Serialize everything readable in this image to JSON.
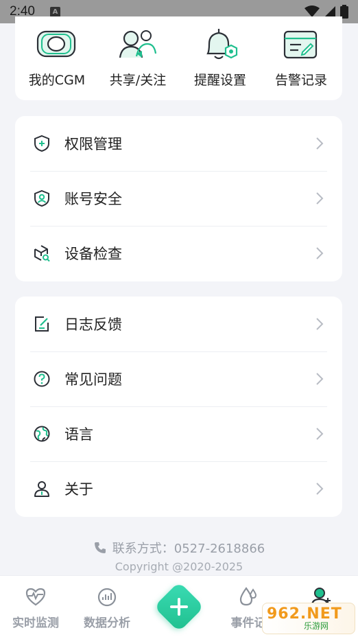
{
  "status_bar": {
    "time": "2:40",
    "notif_glyph": "A"
  },
  "quick_actions": [
    {
      "label": "我的CGM",
      "icon": "cgm-sensor-icon"
    },
    {
      "label": "共享/关注",
      "icon": "share-follow-icon"
    },
    {
      "label": "提醒设置",
      "icon": "reminder-bell-icon"
    },
    {
      "label": "告警记录",
      "icon": "alarm-record-icon"
    }
  ],
  "menu_group_1": [
    {
      "label": "权限管理",
      "icon": "shield-plus-icon"
    },
    {
      "label": "账号安全",
      "icon": "shield-user-icon"
    },
    {
      "label": "设备检查",
      "icon": "device-check-icon"
    }
  ],
  "menu_group_2": [
    {
      "label": "日志反馈",
      "icon": "log-edit-icon"
    },
    {
      "label": "常见问题",
      "icon": "question-circle-icon"
    },
    {
      "label": "语言",
      "icon": "globe-icon"
    },
    {
      "label": "关于",
      "icon": "about-user-icon"
    }
  ],
  "contact": {
    "text": "联系方式：0527-2618866",
    "icon": "phone-icon"
  },
  "copyright": "Copyright @2020-2025",
  "tabs": [
    {
      "label": "实时监测",
      "icon": "heart-pulse-icon"
    },
    {
      "label": "数据分析",
      "icon": "gauge-icon"
    },
    {
      "label": "事件记",
      "icon": "drop-icon"
    },
    {
      "label": "",
      "icon": "user-add-icon"
    }
  ],
  "watermark": {
    "brand": "962.NET",
    "sub": "乐游网"
  },
  "colors": {
    "accent": "#1fbf8e",
    "icon_dark": "#2b2f36",
    "chevron": "#b8bcc4"
  }
}
